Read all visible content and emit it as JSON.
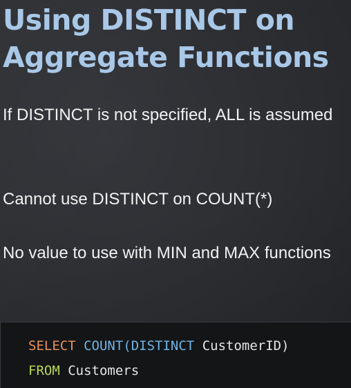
{
  "slide": {
    "title_line1": "Using DISTINCT on",
    "title_line2": "Aggregate Functions",
    "bullets": [
      "If DISTINCT is not specified, ALL is assumed",
      "Cannot use DISTINCT on COUNT(*)",
      "No value to use with MIN and MAX functions"
    ],
    "code": {
      "line1": {
        "keyword": "SELECT",
        "function": "COUNT(DISTINCT",
        "rest": "CustomerID)"
      },
      "line2": {
        "keyword": "FROM",
        "rest": "Customers"
      }
    }
  },
  "colors": {
    "title": "#a9c8e8",
    "text": "#f2f2f2",
    "code_background": "#141517",
    "sql_select": "#e8935a",
    "sql_function": "#6fb4e6",
    "sql_from": "#b8d85a"
  }
}
